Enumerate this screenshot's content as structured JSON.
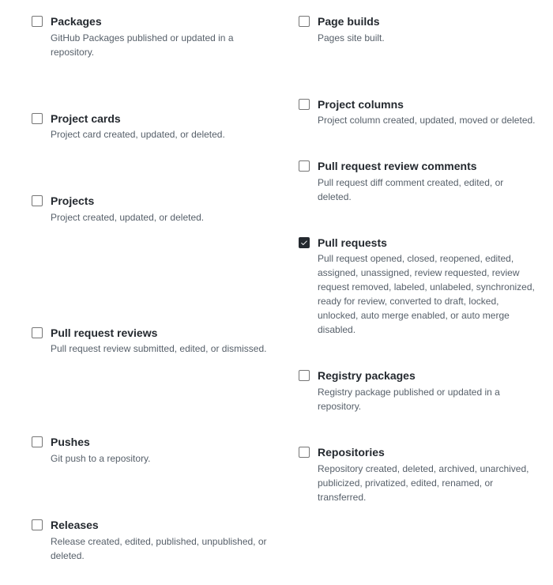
{
  "left": [
    {
      "id": "packages",
      "title": "Packages",
      "desc": "GitHub Packages published or updated in a repository.",
      "checked": false,
      "gap": "m"
    },
    {
      "id": "project-cards",
      "title": "Project cards",
      "desc": "Project card created, updated, or deleted.",
      "checked": false,
      "gap": "m"
    },
    {
      "id": "projects",
      "title": "Projects",
      "desc": "Project created, updated, or deleted.",
      "checked": false,
      "gap": "xl"
    },
    {
      "id": "pull-request-reviews",
      "title": "Pull request reviews",
      "desc": "Pull request review submitted, edited, or dismissed.",
      "checked": false,
      "gap": "l"
    },
    {
      "id": "pushes",
      "title": "Pushes",
      "desc": "Git push to a repository.",
      "checked": false,
      "gap": "m"
    },
    {
      "id": "releases",
      "title": "Releases",
      "desc": "Release created, edited, published, unpublished, or deleted.",
      "checked": false,
      "gap": ""
    }
  ],
  "right": [
    {
      "id": "page-builds",
      "title": "Page builds",
      "desc": "Pages site built.",
      "checked": false,
      "gap": "m"
    },
    {
      "id": "project-columns",
      "title": "Project columns",
      "desc": "Project column created, updated, moved or deleted.",
      "checked": false,
      "gap": "s"
    },
    {
      "id": "pull-request-review-comments",
      "title": "Pull request review comments",
      "desc": "Pull request diff comment created, edited, or deleted.",
      "checked": false,
      "gap": "s"
    },
    {
      "id": "pull-requests",
      "title": "Pull requests",
      "desc": "Pull request opened, closed, reopened, edited, assigned, unassigned, review requested, review request removed, labeled, unlabeled, synchronized, ready for review, converted to draft, locked, unlocked, auto merge enabled, or auto merge disabled.",
      "checked": true,
      "gap": "s"
    },
    {
      "id": "registry-packages",
      "title": "Registry packages",
      "desc": "Registry package published or updated in a repository.",
      "checked": false,
      "gap": "s"
    },
    {
      "id": "repositories",
      "title": "Repositories",
      "desc": "Repository created, deleted, archived, unarchived, publicized, privatized, edited, renamed, or transferred.",
      "checked": false,
      "gap": ""
    }
  ]
}
